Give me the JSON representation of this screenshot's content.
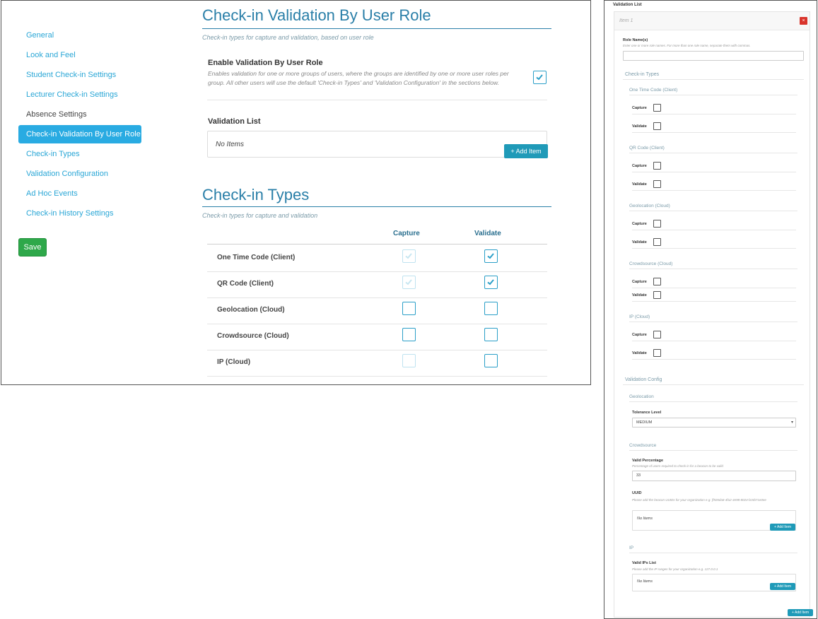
{
  "nav": {
    "items": [
      {
        "label": "General"
      },
      {
        "label": "Look and Feel"
      },
      {
        "label": "Student Check-in Settings"
      },
      {
        "label": "Lecturer Check-in Settings"
      },
      {
        "label": "Absence Settings"
      },
      {
        "label": "Check-in Validation By User Role"
      },
      {
        "label": "Check-in Types"
      },
      {
        "label": "Validation Configuration"
      },
      {
        "label": "Ad Hoc Events"
      },
      {
        "label": "Check-in History Settings"
      }
    ],
    "active_index": 5,
    "save_label": "Save"
  },
  "validation_by_role": {
    "title": "Check-in Validation By User Role",
    "subtitle": "Check-in types for capture and validation, based on user role",
    "enable_label": "Enable Validation By User Role",
    "enable_desc": "Enables validation for one or more groups of users, where the groups are identified by one or more user roles per group. All other users will use the default 'Check-in Types' and 'Validation Configuration' in the sections below.",
    "enabled": true,
    "list_label": "Validation List",
    "no_items": "No Items",
    "add_item": "+ Add Item"
  },
  "checkin_types": {
    "title": "Check-in Types",
    "subtitle": "Check-in types for capture and validation",
    "col_capture": "Capture",
    "col_validate": "Validate",
    "rows": [
      {
        "label": "One Time Code (Client)",
        "capture": true,
        "capture_disabled": true,
        "validate": true
      },
      {
        "label": "QR Code (Client)",
        "capture": true,
        "capture_disabled": true,
        "validate": true
      },
      {
        "label": "Geolocation (Cloud)",
        "capture": false,
        "capture_disabled": false,
        "validate": false
      },
      {
        "label": "Crowdsource (Cloud)",
        "capture": false,
        "capture_disabled": false,
        "validate": false
      },
      {
        "label": "IP (Cloud)",
        "capture": false,
        "capture_disabled": true,
        "validate": false
      }
    ]
  },
  "panel": {
    "heading": "Validation List",
    "item_title": "Item 1",
    "close_glyph": "×",
    "role_label": "Role Name(s)",
    "role_help": "Enter one or more role names. For more than one role name, separate them with commas.",
    "role_value": "",
    "checkin_types_heading": "Check-in Types",
    "capture_label": "Capture",
    "validate_label": "Validate",
    "types": [
      {
        "label": "One Time Code (Client)"
      },
      {
        "label": "QR Code (Client)"
      },
      {
        "label": "Geolocation (Cloud)"
      },
      {
        "label": "Crowdsource (Cloud)"
      },
      {
        "label": "IP (Cloud)"
      }
    ],
    "validation_config_heading": "Validation Config",
    "geolocation_heading": "Geolocation",
    "tolerance_label": "Tolerance Level",
    "tolerance_value": "MEDIUM",
    "crowdsource_heading": "Crowdsource",
    "valid_pct_label": "Valid Percentage",
    "valid_pct_help": "Percentage of users required to check in for a beacon to be valid",
    "valid_pct_value": "33",
    "uuid_label": "UUID",
    "uuid_help": "Please add the beacon UUIDs for your organization e.g. [f926da6-4fa2-4e98-8024-bc5b71e0ee",
    "ip_heading": "IP",
    "valid_ips_label": "Valid IPs List",
    "valid_ips_help": "Please add the IP ranges for your organization e.g. 127.0.0.1",
    "no_items": "No Items",
    "add_item": "+ Add Item"
  }
}
